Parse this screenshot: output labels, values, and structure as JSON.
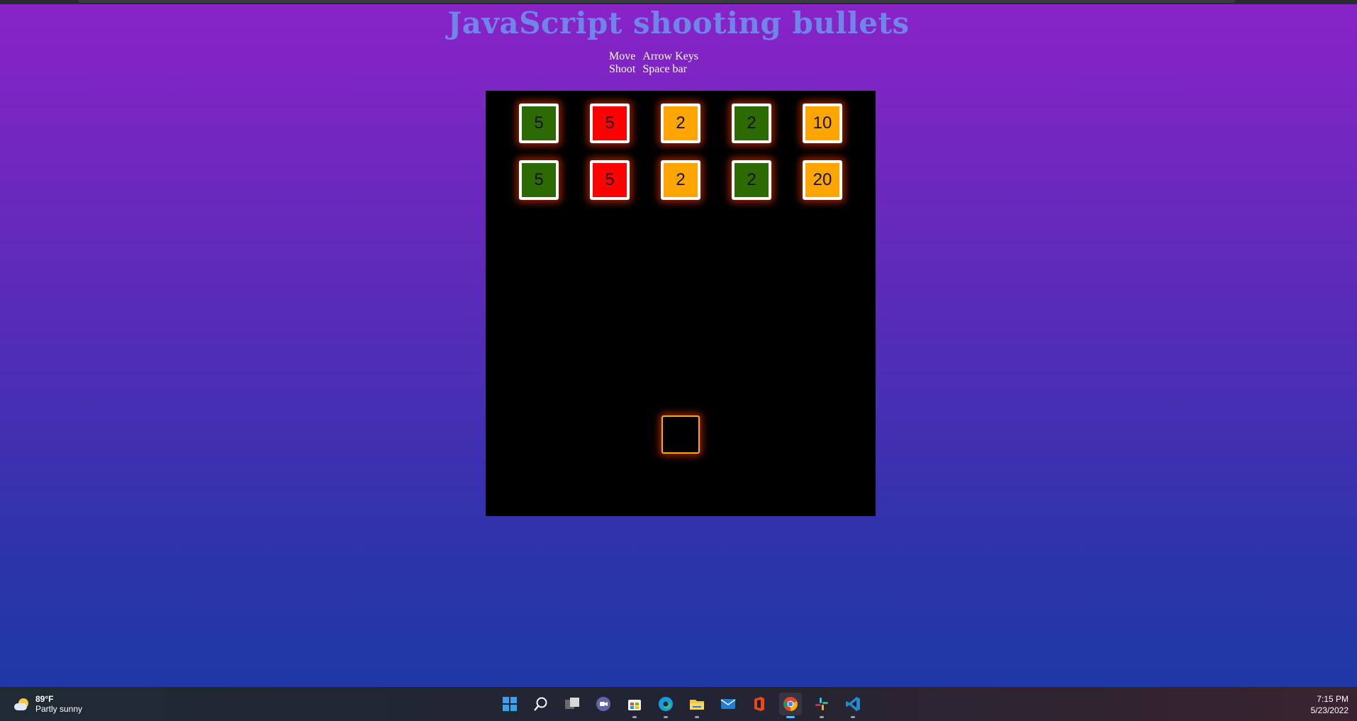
{
  "page": {
    "title": "JavaScript shooting bullets",
    "controls": [
      {
        "action": "Move",
        "key": "Arrow Keys"
      },
      {
        "action": "Shoot",
        "key": "Space bar"
      }
    ]
  },
  "game": {
    "background": "#000000",
    "bricks": [
      {
        "label": "5",
        "color": "#2d6a04"
      },
      {
        "label": "5",
        "color": "#ff0000"
      },
      {
        "label": "2",
        "color": "#ffa500"
      },
      {
        "label": "2",
        "color": "#2d6a04"
      },
      {
        "label": "10",
        "color": "#ffa500"
      },
      {
        "label": "5",
        "color": "#2d6a04"
      },
      {
        "label": "5",
        "color": "#ff0000"
      },
      {
        "label": "2",
        "color": "#ffa500"
      },
      {
        "label": "2",
        "color": "#2d6a04"
      },
      {
        "label": "20",
        "color": "#ffa500"
      }
    ],
    "player": {
      "border_color": "#ffaa00"
    }
  },
  "taskbar": {
    "weather": {
      "temp": "89°F",
      "condition": "Partly sunny"
    },
    "apps": [
      {
        "name": "start-icon"
      },
      {
        "name": "search-icon"
      },
      {
        "name": "task-view-icon"
      },
      {
        "name": "teams-chat-icon"
      },
      {
        "name": "microsoft-store-icon"
      },
      {
        "name": "edge-icon"
      },
      {
        "name": "file-explorer-icon"
      },
      {
        "name": "mail-icon"
      },
      {
        "name": "office-icon"
      },
      {
        "name": "chrome-icon"
      },
      {
        "name": "slack-icon"
      },
      {
        "name": "vscode-icon"
      }
    ],
    "clock": {
      "time": "7:15 PM",
      "date": "5/23/2022"
    }
  }
}
